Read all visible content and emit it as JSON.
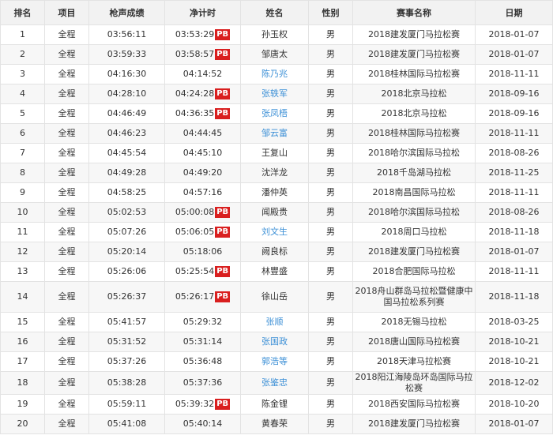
{
  "headers": {
    "rank": "排名",
    "event": "项目",
    "gun_time": "枪声成绩",
    "net_time": "净计时",
    "name": "姓名",
    "gender": "性别",
    "race": "赛事名称",
    "date": "日期"
  },
  "rows": [
    {
      "rank": "1",
      "event": "全程",
      "gun": "03:56:11",
      "net": "03:53:29",
      "pb": "PB",
      "name": "孙玉权",
      "link": false,
      "gender": "男",
      "race": "2018建发厦门马拉松赛",
      "date": "2018-01-07"
    },
    {
      "rank": "2",
      "event": "全程",
      "gun": "03:59:33",
      "net": "03:58:57",
      "pb": "PB",
      "name": "邹唐太",
      "link": false,
      "gender": "男",
      "race": "2018建发厦门马拉松赛",
      "date": "2018-01-07"
    },
    {
      "rank": "3",
      "event": "全程",
      "gun": "04:16:30",
      "net": "04:14:52",
      "pb": "",
      "name": "陈乃兆",
      "link": true,
      "gender": "男",
      "race": "2018桂林国际马拉松赛",
      "date": "2018-11-11"
    },
    {
      "rank": "4",
      "event": "全程",
      "gun": "04:28:10",
      "net": "04:24:28",
      "pb": "PB",
      "name": "张轶军",
      "link": true,
      "gender": "男",
      "race": "2018北京马拉松",
      "date": "2018-09-16"
    },
    {
      "rank": "5",
      "event": "全程",
      "gun": "04:46:49",
      "net": "04:36:35",
      "pb": "PB",
      "name": "张凤梧",
      "link": true,
      "gender": "男",
      "race": "2018北京马拉松",
      "date": "2018-09-16"
    },
    {
      "rank": "6",
      "event": "全程",
      "gun": "04:46:23",
      "net": "04:44:45",
      "pb": "",
      "name": "邹云富",
      "link": true,
      "gender": "男",
      "race": "2018桂林国际马拉松赛",
      "date": "2018-11-11"
    },
    {
      "rank": "7",
      "event": "全程",
      "gun": "04:45:54",
      "net": "04:45:10",
      "pb": "",
      "name": "王复山",
      "link": false,
      "gender": "男",
      "race": "2018哈尔滨国际马拉松",
      "date": "2018-08-26"
    },
    {
      "rank": "8",
      "event": "全程",
      "gun": "04:49:28",
      "net": "04:49:20",
      "pb": "",
      "name": "沈洋龙",
      "link": false,
      "gender": "男",
      "race": "2018千岛湖马拉松",
      "date": "2018-11-25"
    },
    {
      "rank": "9",
      "event": "全程",
      "gun": "04:58:25",
      "net": "04:57:16",
      "pb": "",
      "name": "潘仲英",
      "link": false,
      "gender": "男",
      "race": "2018南昌国际马拉松",
      "date": "2018-11-11"
    },
    {
      "rank": "10",
      "event": "全程",
      "gun": "05:02:53",
      "net": "05:00:08",
      "pb": "PB",
      "name": "闻殿贵",
      "link": false,
      "gender": "男",
      "race": "2018哈尔滨国际马拉松",
      "date": "2018-08-26"
    },
    {
      "rank": "11",
      "event": "全程",
      "gun": "05:07:26",
      "net": "05:06:05",
      "pb": "PB",
      "name": "刘文生",
      "link": true,
      "gender": "男",
      "race": "2018周口马拉松",
      "date": "2018-11-18"
    },
    {
      "rank": "12",
      "event": "全程",
      "gun": "05:20:14",
      "net": "05:18:06",
      "pb": "",
      "name": "阙良标",
      "link": false,
      "gender": "男",
      "race": "2018建发厦门马拉松赛",
      "date": "2018-01-07"
    },
    {
      "rank": "13",
      "event": "全程",
      "gun": "05:26:06",
      "net": "05:25:54",
      "pb": "PB",
      "name": "林豐盛",
      "link": false,
      "gender": "男",
      "race": "2018合肥国际马拉松",
      "date": "2018-11-11"
    },
    {
      "rank": "14",
      "event": "全程",
      "gun": "05:26:37",
      "net": "05:26:17",
      "pb": "PB",
      "name": "徐山岳",
      "link": false,
      "gender": "男",
      "race": "2018舟山群岛马拉松暨健康中国马拉松系列赛",
      "date": "2018-11-18"
    },
    {
      "rank": "15",
      "event": "全程",
      "gun": "05:41:57",
      "net": "05:29:32",
      "pb": "",
      "name": "张顺",
      "link": true,
      "gender": "男",
      "race": "2018无锡马拉松",
      "date": "2018-03-25"
    },
    {
      "rank": "16",
      "event": "全程",
      "gun": "05:31:52",
      "net": "05:31:14",
      "pb": "",
      "name": "张国政",
      "link": true,
      "gender": "男",
      "race": "2018唐山国际马拉松赛",
      "date": "2018-10-21"
    },
    {
      "rank": "17",
      "event": "全程",
      "gun": "05:37:26",
      "net": "05:36:48",
      "pb": "",
      "name": "郭浩等",
      "link": true,
      "gender": "男",
      "race": "2018天津马拉松赛",
      "date": "2018-10-21"
    },
    {
      "rank": "18",
      "event": "全程",
      "gun": "05:38:28",
      "net": "05:37:36",
      "pb": "",
      "name": "张鉴忠",
      "link": true,
      "gender": "男",
      "race": "2018阳江海陵岛环岛国际马拉松赛",
      "date": "2018-12-02"
    },
    {
      "rank": "19",
      "event": "全程",
      "gun": "05:59:11",
      "net": "05:39:32",
      "pb": "PB",
      "name": "陈金锂",
      "link": false,
      "gender": "男",
      "race": "2018西安国际马拉松赛",
      "date": "2018-10-20"
    },
    {
      "rank": "20",
      "event": "全程",
      "gun": "05:41:08",
      "net": "05:40:14",
      "pb": "",
      "name": "黄春荣",
      "link": false,
      "gender": "男",
      "race": "2018建发厦门马拉松赛",
      "date": "2018-01-07"
    }
  ]
}
